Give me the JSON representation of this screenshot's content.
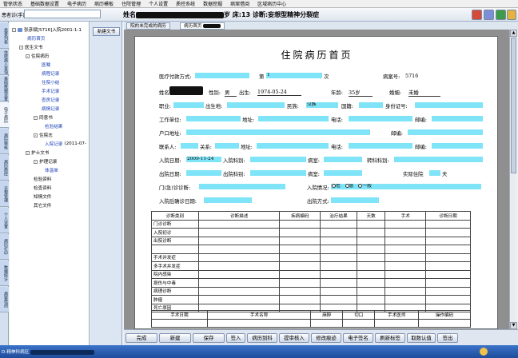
{
  "menu": [
    "管徐状态",
    "基础数据设置",
    "电子病历",
    "病历模板",
    "住院管理",
    "个人设置",
    "质控系统",
    "数据挖掘",
    "病案借阅",
    "区域病历中心"
  ],
  "toolbar": {
    "search_label": "患者诊(手)号",
    "banner_prefix": "姓名",
    "banner_suffix": "岁 床:13 诊断:妄想型精神分裂症"
  },
  "vertical_tabs": [
    "患者列表",
    "住院病人查询",
    "基础数据设置",
    "电子病历",
    "病历审核",
    "病历质控",
    "日程管理",
    "个人设置",
    "病历打印",
    "数据统计",
    "病案借阅"
  ],
  "tree": {
    "root": "张彦斌[5716]入院2001-1-1",
    "items": [
      "病历首页",
      "医生文书",
      "住院病历",
      "医嘱",
      "病程记录",
      "住院小结",
      "手术记录",
      "查房记录",
      "病情记录",
      "同意书",
      "检验结果",
      "住院志",
      "入院记录",
      "(2011-07-",
      "护士文书",
      "护理记录",
      "体温单",
      "检验资料",
      "检查资料",
      "知情文件",
      "其它文件"
    ]
  },
  "mid": {
    "new_doc": "新建文书"
  },
  "tabs": [
    "院的未完成的病历",
    "病历首页"
  ],
  "doc": {
    "title": "住院病历首页",
    "pay_label": "医疗付款方式:",
    "times_label": "第",
    "times_value": "1",
    "times_unit": "次",
    "case_label": "病案号:",
    "case_no": "5716",
    "name_label": "姓名",
    "sex_label": "性别:",
    "sex": "男",
    "birth_label": "出生:",
    "birth": "1974-05-24",
    "age_label": "年龄:",
    "age": "35岁",
    "marriage_label": "婚姻:",
    "marriage": "未婚",
    "job_label": "职业:",
    "birthplace_label": "出生地:",
    "nation_label": "民族:",
    "nation": "汉族",
    "country_label": "国籍:",
    "id_label": "身份证号:",
    "work_label": "工作单位:",
    "addr_label": "地址:",
    "phone_label": "电话:",
    "post_label": "邮编:",
    "home_label": "户口地址:",
    "post2_label": "邮编:",
    "contact_label": "联系人:",
    "rel_label": "关系:",
    "addr2_label": "地址:",
    "phone2_label": "电话:",
    "post3_label": "邮编:",
    "admit_label": "入院日期:",
    "admit_date": "2009-11-24",
    "admit_dept_label": "入院科别:",
    "room_label": "病室:",
    "transfer_label": "转科科别:",
    "disch_label": "出院日期:",
    "disch_dept_label": "出院科别:",
    "room2_label": "病室:",
    "days_label": "实际住院",
    "days_unit": "天",
    "opd_label": "门(急)诊诊断:",
    "cond_label": "入院情况:",
    "cond_opts": [
      "危",
      "急",
      "一般"
    ],
    "confirm_label": "入院后确诊日期:",
    "disch_mode_label": "出院方式:",
    "diag_headers": [
      "诊断类别",
      "诊断描述",
      "疾病编码",
      "治疗结果",
      "天数",
      "手术",
      "诊断日期"
    ],
    "diag_rows": [
      "门诊诊断",
      "入院初诊",
      "出院诊断",
      "",
      "手术并发症",
      "多手术并发症",
      "院内感染",
      "损伤与中毒",
      "病理诊断",
      "肿瘤",
      "死亡原因"
    ],
    "op_headers": [
      "手术日期",
      "手术名称",
      "麻醉",
      "切口",
      "手术医师",
      "操作编码"
    ]
  },
  "buttons": [
    "完成",
    "新建",
    "保存",
    "签入",
    "病历到科",
    "提审核入",
    "修改痕迹",
    "电子签名",
    "刷新标签",
    "取数认值",
    "签出"
  ],
  "status": {
    "left": "D-精神科病区"
  }
}
